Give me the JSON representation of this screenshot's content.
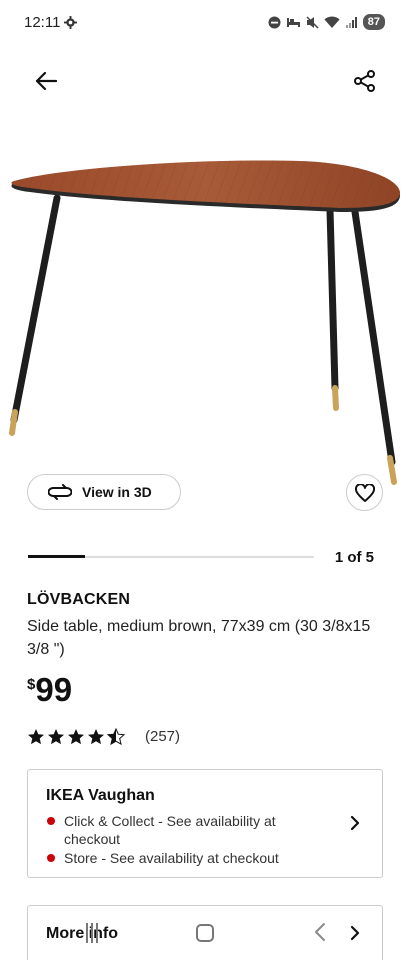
{
  "status_bar": {
    "time": "12:11",
    "battery": "87"
  },
  "product": {
    "name": "LÖVBACKEN",
    "description": "Side table, medium brown, 77x39 cm (30 3/8x15 3/8 \")",
    "price_currency": "$",
    "price_value": "99",
    "rating": 4.5,
    "rating_max": 5,
    "review_count": "(257)"
  },
  "gallery": {
    "view_3d_label": "View in 3D",
    "pager": "1 of 5",
    "progress": 0.2
  },
  "store": {
    "name": "IKEA Vaughan",
    "availability": [
      {
        "label": "Click & Collect - See availability at checkout"
      },
      {
        "label": "Store - See availability at checkout"
      }
    ],
    "status_color": "#cc0008"
  },
  "more_info": {
    "label": "More info"
  },
  "icons": {
    "back": "arrow-left-icon",
    "share": "share-icon",
    "view_3d": "rotate-3d-icon",
    "favourite": "heart-icon",
    "rating": "star-icon",
    "chevron": "chevron-right-icon"
  }
}
